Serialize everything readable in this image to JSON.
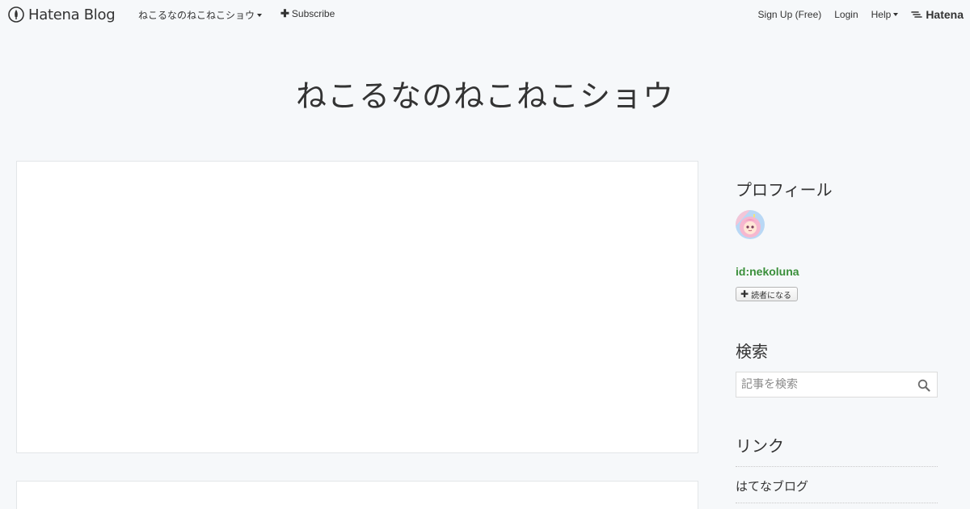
{
  "global_header": {
    "logo_text": "Hatena Blog",
    "blog_name": "ねこるなのねこねこショウ",
    "subscribe_label": "Subscribe",
    "signup_label": "Sign Up (Free)",
    "login_label": "Login",
    "help_label": "Help",
    "hatena_label": "Hatena"
  },
  "blog": {
    "title": "ねこるなのねこねこショウ"
  },
  "sidebar": {
    "profile": {
      "title": "プロフィール",
      "id": "id:nekoluna",
      "reader_button": "読者になる"
    },
    "search": {
      "title": "検索",
      "placeholder": "記事を検索"
    },
    "links": {
      "title": "リンク",
      "items": [
        {
          "label": "はてなブログ"
        }
      ]
    }
  },
  "colors": {
    "background": "#f6f8fa",
    "id_link": "#3a8f3a",
    "text": "#333333"
  }
}
